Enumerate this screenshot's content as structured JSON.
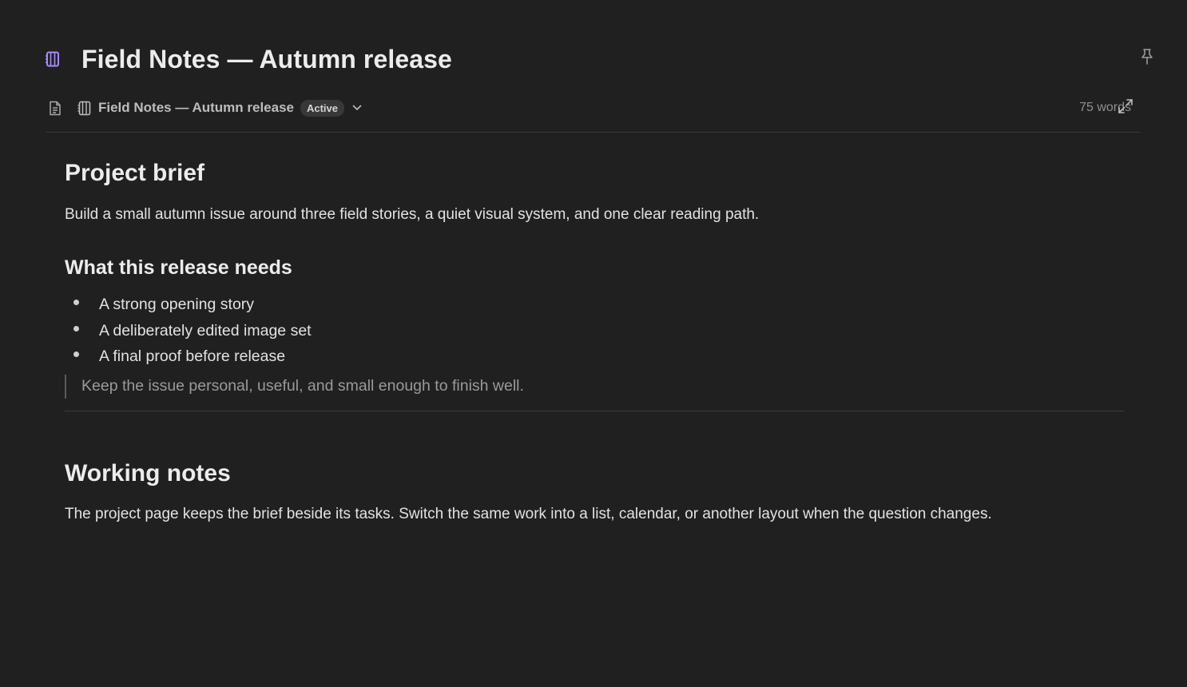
{
  "header": {
    "title": "Field Notes — Autumn release",
    "title_icon": "notebook-icon",
    "pin_icon": "pin-icon"
  },
  "toolbar": {
    "doc_icon": "document-icon",
    "breadcrumb_icon": "notebook-icon",
    "breadcrumb_title": "Field Notes — Autumn release",
    "status": "Active",
    "chevron_icon": "chevron-down-icon",
    "word_count": "75 words",
    "expand_icon": "expand-icon"
  },
  "content": {
    "brief_heading": "Project brief",
    "brief_text": "Build a small autumn issue around three field stories, a quiet visual system, and one clear reading path.",
    "needs_heading": "What this release needs",
    "needs": [
      "A strong opening story",
      "A deliberately edited image set",
      "A final proof before release"
    ],
    "quote": "Keep the issue personal, useful, and small enough to finish well.",
    "notes_heading": "Working notes",
    "notes_text": "The project page keeps the brief beside its tasks. Switch the same work into a list, calendar, or another layout when the question changes."
  },
  "colors": {
    "background": "#202020",
    "accent_icon": "#a78bfa",
    "text_primary": "#ececec",
    "text_muted": "#8f8f8f"
  }
}
